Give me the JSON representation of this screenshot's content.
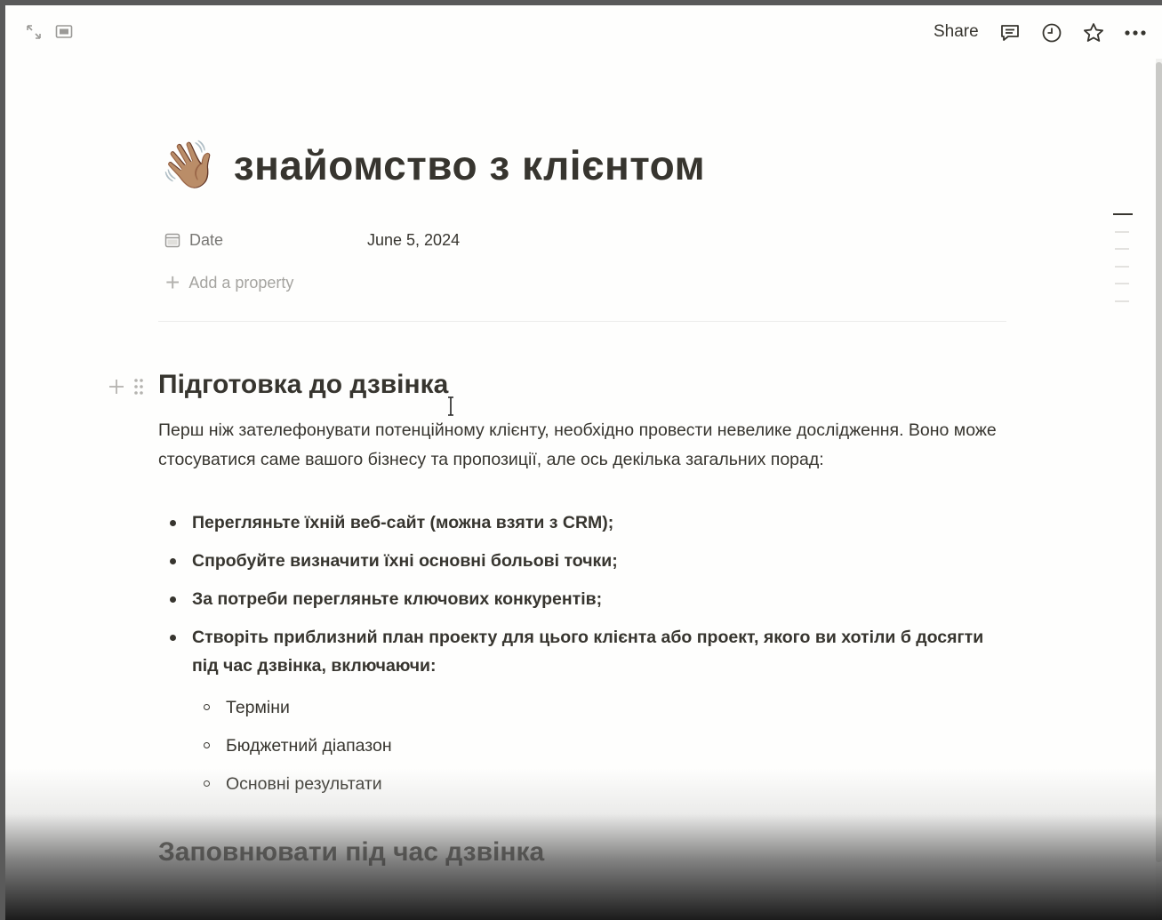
{
  "topbar": {
    "share_label": "Share",
    "left_icons": [
      "expand-icon",
      "peek-mode-icon"
    ],
    "right_icons": [
      "comments-icon",
      "history-icon",
      "favorite-star-icon",
      "more-options-icon"
    ]
  },
  "page": {
    "emoji": "👋🏽",
    "title": "знайомство з клієнтом",
    "properties": [
      {
        "icon": "calendar-icon",
        "name": "Date",
        "value": "June 5, 2024"
      }
    ],
    "add_property_label": "Add a property",
    "section1": {
      "heading": "Підготовка до дзвінка",
      "paragraph": "Перш ніж зателефонувати потенційному клієнту, необхідно провести невелике дослідження. Воно може стосуватися саме вашого бізнесу та пропозиції, але ось  декілька загальних порад:",
      "bullets": [
        "Перегляньте їхній веб-сайт (можна взяти з CRM);",
        "Спробуйте визначити їхні основні больові точки;",
        "За потреби перегляньте ключових конкурентів;",
        "Створіть приблизний план проекту для цього клієнта або проект, якого ви хотіли б досягти під час дзвінка, включаючи:"
      ],
      "sub_bullets": [
        "Терміни",
        "Бюджетний діапазон",
        "Основні результати"
      ]
    },
    "section2": {
      "heading": "Заповнювати під час дзвінка"
    }
  },
  "colors": {
    "text": "#37352f",
    "muted": "#787774",
    "placeholder": "#a5a4a0",
    "background": "#fefefd"
  }
}
